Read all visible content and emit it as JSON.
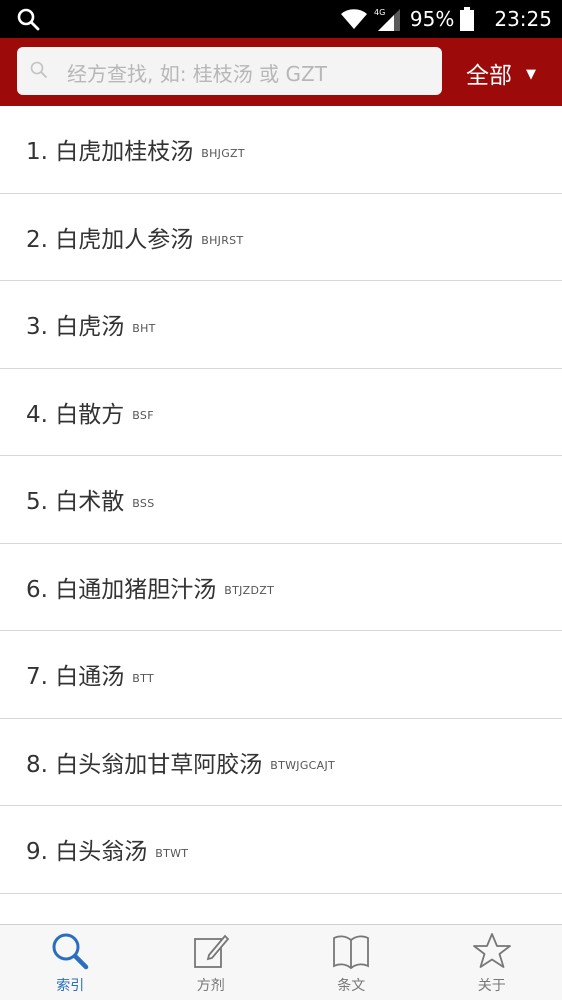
{
  "status_bar": {
    "network": "4G",
    "battery": "95%",
    "time": "23:25"
  },
  "header": {
    "search_placeholder": "经方查找, 如: 桂枝汤 或 GZT",
    "filter_label": "全部",
    "filter_arrow": "▼"
  },
  "list": [
    {
      "name": "1. 白虎加桂枝汤",
      "abbr": "BHJGZT"
    },
    {
      "name": "2. 白虎加人参汤",
      "abbr": "BHJRST"
    },
    {
      "name": "3. 白虎汤",
      "abbr": "BHT"
    },
    {
      "name": "4. 白散方",
      "abbr": "BSF"
    },
    {
      "name": "5. 白术散",
      "abbr": "BSS"
    },
    {
      "name": "6. 白通加猪胆汁汤",
      "abbr": "BTJZDZT"
    },
    {
      "name": "7. 白通汤",
      "abbr": "BTT"
    },
    {
      "name": "8. 白头翁加甘草阿胶汤",
      "abbr": "BTWJGCAJT"
    },
    {
      "name": "9. 白头翁汤",
      "abbr": "BTWT"
    }
  ],
  "tabs": [
    {
      "label": "索引",
      "icon": "magnifier-icon",
      "active": true
    },
    {
      "label": "方剂",
      "icon": "edit-icon",
      "active": false
    },
    {
      "label": "条文",
      "icon": "book-icon",
      "active": false
    },
    {
      "label": "关于",
      "icon": "star-icon",
      "active": false
    }
  ],
  "colors": {
    "header": "#9c0a0a",
    "active_tab": "#2a6ec0"
  }
}
